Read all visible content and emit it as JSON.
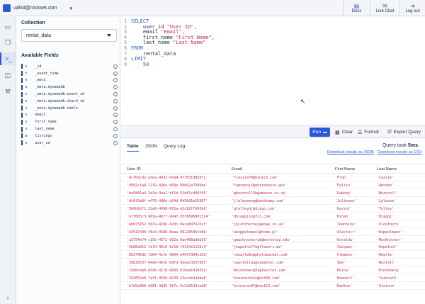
{
  "topbar": {
    "account": "vahid@rockset.com",
    "actions": [
      {
        "label": "Docs",
        "icon": "docs-icon"
      },
      {
        "label": "Live Chat",
        "icon": "chat-icon"
      },
      {
        "label": "Log out",
        "icon": "logout-icon"
      }
    ]
  },
  "left": {
    "collection_title": "Collection",
    "collection_value": "rental_data",
    "fields_title": "Available Fields",
    "fields": [
      {
        "type": "s",
        "name": "_id"
      },
      {
        "type": "t",
        "name": "_event_time"
      },
      {
        "type": "o",
        "name": "_meta"
      },
      {
        "type": "o",
        "name": "_meta.dynamodb"
      },
      {
        "type": "s",
        "name": "_meta.dynamodb.event_id"
      },
      {
        "type": "s",
        "name": "_meta.dynamodb.shard_id"
      },
      {
        "type": "s",
        "name": "_meta.dynamodb.table"
      },
      {
        "type": "s",
        "name": "email"
      },
      {
        "type": "s",
        "name": "first_name"
      },
      {
        "type": "s",
        "name": "last_name"
      },
      {
        "type": "a",
        "name": "listings"
      },
      {
        "type": "s",
        "name": "user_id"
      }
    ]
  },
  "editor": {
    "lines": [
      {
        "n": "1",
        "kw": "SELECT",
        "rest": ""
      },
      {
        "n": "2",
        "kw": "",
        "rest": "    user_id \"User ID\","
      },
      {
        "n": "3",
        "kw": "",
        "rest": "    email \"Email\","
      },
      {
        "n": "4",
        "kw": "",
        "rest": "    first_name \"First Name\","
      },
      {
        "n": "5",
        "kw": "",
        "rest": "    last_name \"Last Name\""
      },
      {
        "n": "6",
        "kw": "FROM",
        "rest": ""
      },
      {
        "n": "7",
        "kw": "",
        "rest": "    rental_data"
      },
      {
        "n": "8",
        "kw": "LIMIT",
        "rest": ""
      },
      {
        "n": "9",
        "kw": "",
        "rest": "    50"
      }
    ]
  },
  "toolbar": {
    "run": "Run",
    "clear": "Clear",
    "format": "Format",
    "export": "Export Query"
  },
  "results": {
    "tabs": [
      "Table",
      "JSON",
      "Query Log"
    ],
    "query_time_prefix": "Query took ",
    "query_time": "5ms",
    "download_json": "Download results as JSON",
    "download_csv": "Download results as CSV",
    "columns": [
      "User ID",
      "Email",
      "First Name",
      "Last Name"
    ],
    "rows": [
      [
        "'4cf0ac82-a3ea-4033-93a4-97703138b9f1'",
        "'flazzie70@hao123.com'",
        "'Fran'",
        "'Lazzie'"
      ],
      [
        "'0992c1a8-7232-436e-b09e-99662a7589be'",
        "'famsdenjf@whitehouse.gov'",
        "'Falito'",
        "'Amsden'"
      ],
      [
        "'ba5881a4-3e3a-4ea1-bf1d-52b81cd96f05'",
        "'gbuzsnoll5b@amazon.co.uk'",
        "'Gabbey'",
        "'Buzsnoll'"
      ],
      [
        "'dc8f3a8f-e470-4d8e-a94d-0b5b91e15907'",
        "'jlaleveeoq@bandcamp.com'",
        "'Julienne'",
        "'Lalevee'"
      ],
      [
        "'5b6b92f1-32e8-4098-8f1a-e5c82ff693b6'",
        "'gtulleydj@diigo.com'",
        "'Garzot'",
        "'Tulley'"
      ],
      [
        "'b7f685c3-981a-4bff-9d47-35f6896901324'",
        "'dbiaggilk@fc2.com'",
        "'Dinah'",
        "'Biaggi'"
      ],
      [
        "'eb073252-587a-429b-82dc-0aca8d762b2f'",
        "'jpickthorne2@ebay.co.uk'",
        "'Jeannine'",
        "'Pickthorn'"
      ],
      [
        "'64517d30-f6c9-4588-8eaa-99128505cb6b'",
        "'akoppelmann2@home.pl'",
        "'Alasteir'",
        "'Koppelmann'"
      ],
      [
        "'a3754e74-c15b-4572-932a-6ae468adbb55'",
        "'gmacknockerim@berkeley.edu'",
        "'Geralda'",
        "'MacKnocker'"
      ],
      [
        "'5b06dd12-fa7d-40c0-8c5d-f4314e1128c4'",
        "'jkapelhof7e@flavors.me'",
        "'Jacques'",
        "'Kapelhof'"
      ],
      [
        "'602746d2-fd84-4cfb-9844-e4647304c15d'",
        "'chearle8x@photobucket.com'",
        "'Clemens'",
        "'Hearle'"
      ],
      [
        "'3db28537-64d0-4b1b-b8fd-92aac3b3fd05'",
        "'iwastallau@symantec.com'",
        "'Ike'",
        "'Wastall'"
      ],
      [
        "'15d0cab6-b5d6-4178-9b83-910a4142835a'",
        "'mhindsberg91@twitter.com'",
        "'Moina'",
        "'Hindsberg'"
      ],
      [
        "'192052e8-7aff-4598-8239-23eccb2a4da6'",
        "'hteznouth1n@hc360.com'",
        "'Hasbert'",
        "'Teznouth'"
      ],
      [
        "'b7d5e860-d981-4d35-9f7c-3c5a9133cbb8'",
        "'hsteinoz97@hao123.com'",
        "'Hadlee'",
        "'Steinoz'"
      ]
    ]
  }
}
